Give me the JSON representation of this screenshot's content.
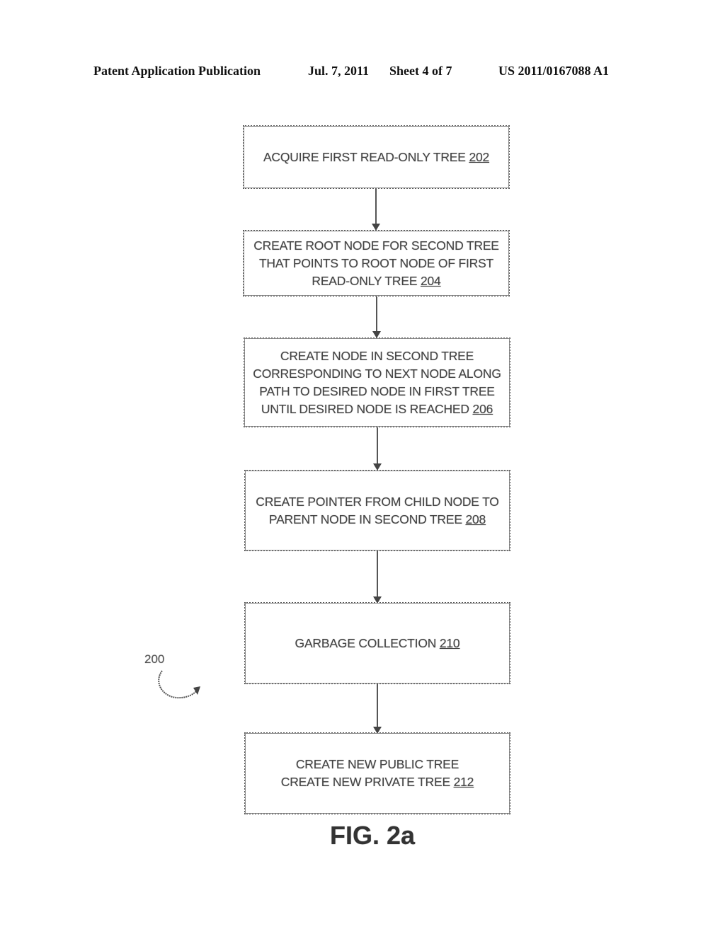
{
  "header": {
    "publication": "Patent Application Publication",
    "date": "Jul. 7, 2011",
    "sheet": "Sheet 4 of 7",
    "number": "US 2011/0167088 A1"
  },
  "flowchart": {
    "reference_label": "200",
    "steps": [
      {
        "lines": [
          "ACQUIRE FIRST READ-ONLY TREE"
        ],
        "ref": "202"
      },
      {
        "lines": [
          "CREATE ROOT NODE FOR SECOND TREE",
          "THAT POINTS TO ROOT NODE OF FIRST",
          "READ-ONLY TREE"
        ],
        "ref": "204"
      },
      {
        "lines": [
          "CREATE NODE IN SECOND TREE",
          "CORRESPONDING TO NEXT NODE ALONG",
          "PATH TO DESIRED NODE IN FIRST TREE",
          "UNTIL DESIRED NODE IS REACHED"
        ],
        "ref": "206"
      },
      {
        "lines": [
          "CREATE POINTER FROM CHILD NODE TO",
          "PARENT NODE IN SECOND TREE"
        ],
        "ref": "208"
      },
      {
        "lines": [
          "GARBAGE COLLECTION"
        ],
        "ref": "210"
      },
      {
        "lines": [
          "CREATE NEW PUBLIC TREE",
          "CREATE NEW PRIVATE TREE"
        ],
        "ref": "212"
      }
    ]
  },
  "figure_label": "FIG. 2a"
}
